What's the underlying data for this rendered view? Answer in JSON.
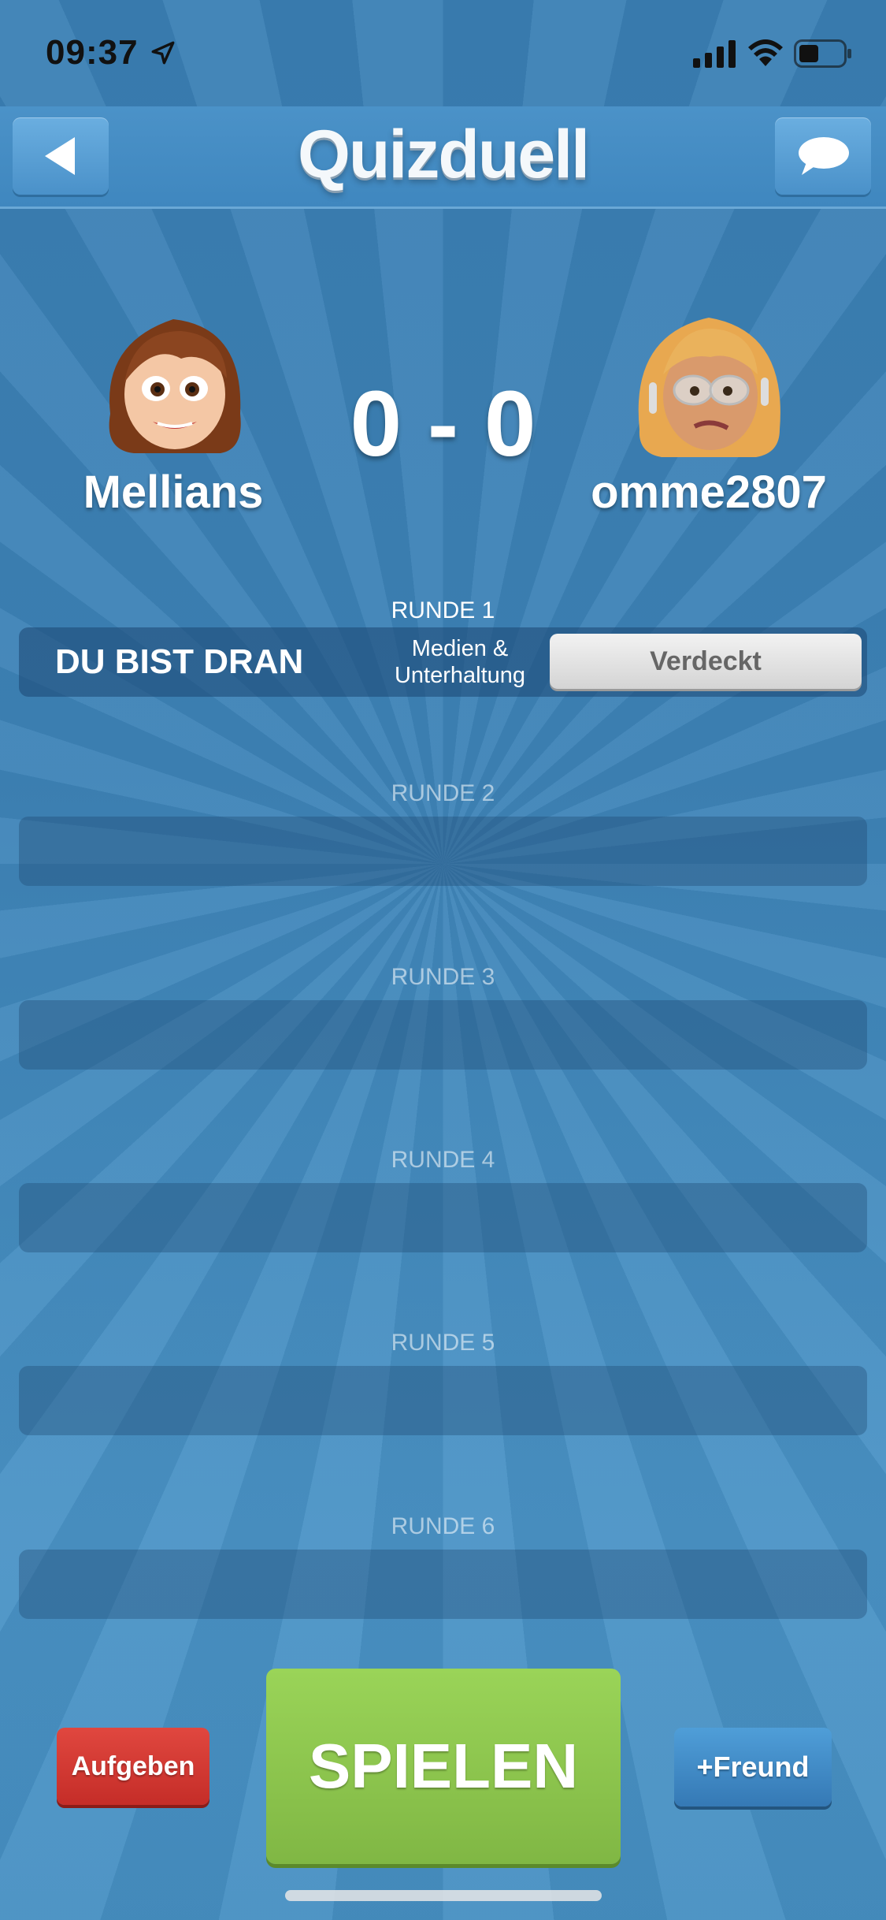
{
  "status_bar": {
    "time": "09:37"
  },
  "header": {
    "title": "Quizduell"
  },
  "players": {
    "left": {
      "name": "Mellians"
    },
    "right": {
      "name": "omme2807"
    }
  },
  "score": "0 - 0",
  "rounds": [
    {
      "label": "RUNDE 1",
      "turn": "DU BIST DRAN",
      "category_line1": "Medien &",
      "category_line2": "Unterhaltung",
      "status": "Verdeckt"
    },
    {
      "label": "RUNDE 2"
    },
    {
      "label": "RUNDE 3"
    },
    {
      "label": "RUNDE 4"
    },
    {
      "label": "RUNDE 5"
    },
    {
      "label": "RUNDE 6"
    }
  ],
  "actions": {
    "give_up": "Aufgeben",
    "play": "SPIELEN",
    "add_friend": "+Freund"
  },
  "colors": {
    "background": "#3f86ba",
    "give_up": "#d63a34",
    "play": "#8dc64e",
    "add_friend": "#3f8bc6"
  },
  "icons": [
    "location-arrow-icon",
    "signal-icon",
    "wifi-icon",
    "battery-icon",
    "back-arrow-icon",
    "chat-bubble-icon"
  ]
}
